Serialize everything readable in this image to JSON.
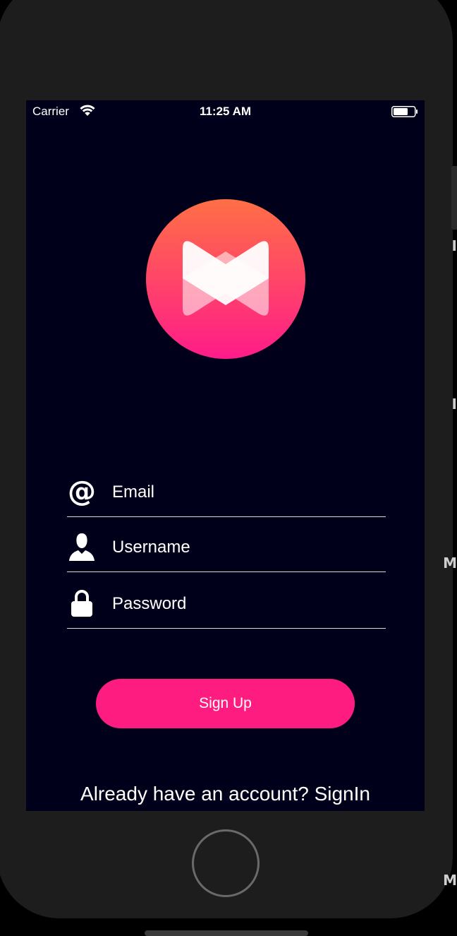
{
  "status_bar": {
    "carrier": "Carrier",
    "time": "11:25 AM"
  },
  "logo": {
    "icon": "bowtie-m-logo",
    "gradient_top": "#ff6f45",
    "gradient_bottom": "#ff1c8a"
  },
  "form": {
    "email": {
      "icon": "at-icon",
      "placeholder": "Email",
      "value": ""
    },
    "username": {
      "icon": "user-icon",
      "placeholder": "Username",
      "value": ""
    },
    "password": {
      "icon": "lock-icon",
      "placeholder": "Password",
      "value": ""
    }
  },
  "actions": {
    "signup_label": "Sign Up",
    "signin_prompt": "Already have an account? SignIn"
  },
  "colors": {
    "screen_bg": "#00001a",
    "accent": "#ff1c80",
    "bezel": "#1d1d1d"
  }
}
